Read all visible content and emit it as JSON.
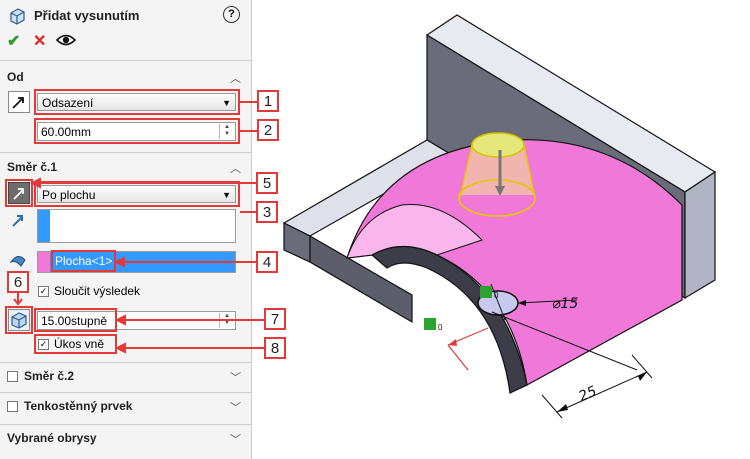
{
  "header": {
    "title": "Přidat vysunutím",
    "help_icon": "?"
  },
  "actions": {
    "ok": "✔",
    "cancel": "✕",
    "preview": "eye-icon"
  },
  "section_from": {
    "title": "Od",
    "type_value": "Odsazení",
    "offset_value": "60.00mm"
  },
  "section_dir1": {
    "title": "Směr č.1",
    "end_condition": "Po plochu",
    "face_item": "Plocha<1>",
    "merge_label": "Sloučit výsledek",
    "draft_value": "15.00stupně",
    "draft_out_label": "Úkos vně"
  },
  "collapsed_sections": {
    "dir2": "Směr č.2",
    "thin": "Tenkostěnný prvek",
    "contours": "Vybrané obrysy"
  },
  "callouts": {
    "n1": "1",
    "n2": "2",
    "n3": "3",
    "n4": "4",
    "n5": "5",
    "n6": "6",
    "n7": "7",
    "n8": "8"
  },
  "model": {
    "dim_diameter": "⌀15",
    "dim_length": "25",
    "marker_1": "0",
    "marker_2": "0"
  },
  "colors": {
    "accent_red": "#e23a3a",
    "face_pink": "#f078d8",
    "selection_blue": "#3399ff"
  }
}
